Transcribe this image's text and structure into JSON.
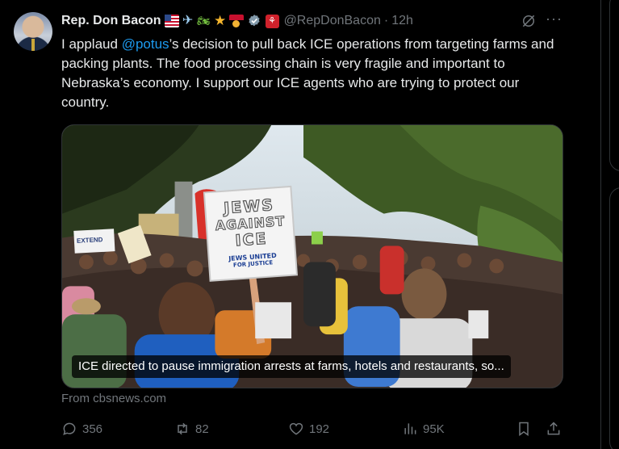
{
  "post": {
    "author_name": "Rep. Don Bacon",
    "name_emojis": [
      "us-flag-icon",
      "airplane-icon",
      "motorcycle-icon",
      "star-icon",
      "medal-icon"
    ],
    "handle": "@RepDonBacon",
    "separator": "·",
    "time": "12h",
    "text_before_mention": "I applaud ",
    "mention": "@potus",
    "text_after_mention": "’s decision to pull back ICE operations from targeting farms and packing plants. The food processing chain is very fragile and important to Nebraska’s economy. I support our ICE agents who are trying to protect our country.",
    "card": {
      "caption": "ICE directed to pause immigration arrests at farms, hotels and restaurants, so...",
      "sign_line1": "JEWS",
      "sign_line2": "AGAINST",
      "sign_line3": "ICE",
      "sign_org1": "JEWS UNITED",
      "sign_org2": "FOR JUSTICE",
      "bg_sign": "EXTEND",
      "source": "From cbsnews.com"
    },
    "actions": {
      "replies": "356",
      "reposts": "82",
      "likes": "192",
      "views": "95K"
    }
  },
  "colors": {
    "background": "#000000",
    "text": "#e7e9ea",
    "muted": "#71767b",
    "link": "#1d9bf0",
    "border": "#2f3336"
  }
}
